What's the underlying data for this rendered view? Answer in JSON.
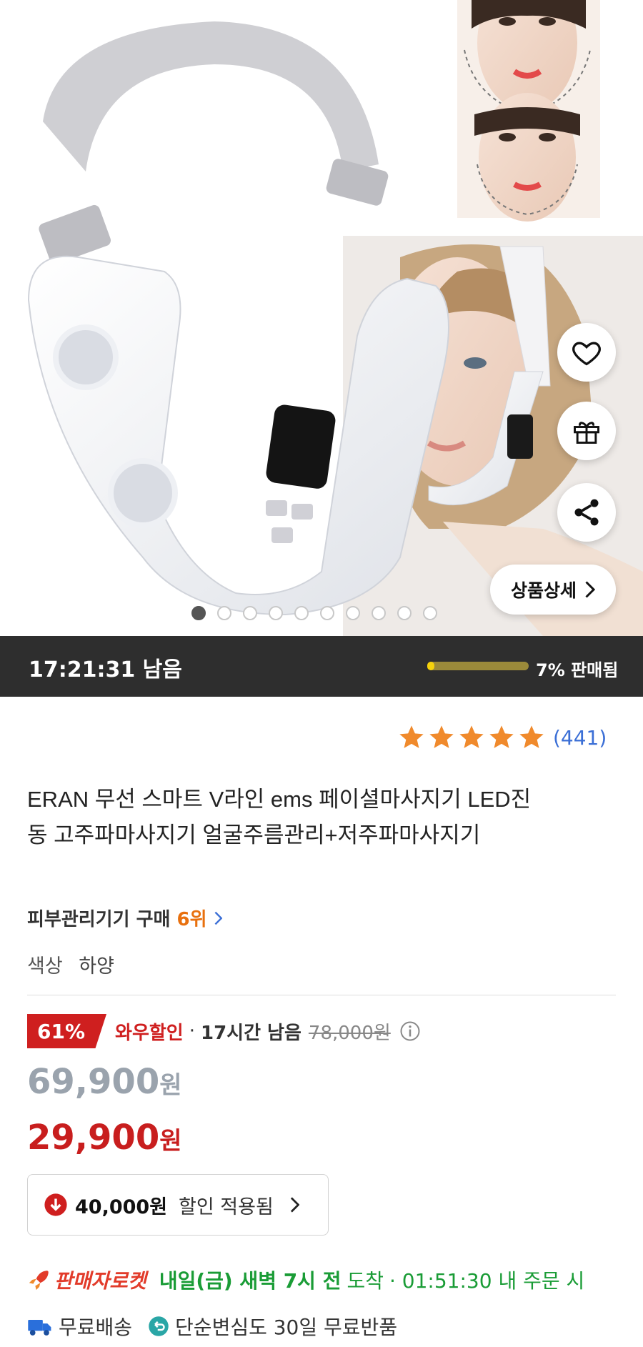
{
  "gallery": {
    "image_alt": "V-line face massager product with model",
    "detail_button": "상품상세",
    "page_count": 10,
    "active_index": 0
  },
  "deal": {
    "countdown": "17:21:31 남음",
    "sold_percent": 7,
    "sold_label": "7% 판매됨"
  },
  "rating": {
    "stars": 5,
    "review_count": "(441)"
  },
  "product": {
    "title": "ERAN 무선 스마트 V라인 ems 페이셜마사지기 LED진동 고주파마사지기 얼굴주름관리+저주파마사지기",
    "rank_prefix": "피부관리기기 구매",
    "rank_value": "6위",
    "option_label": "색상",
    "option_value": "하양"
  },
  "pricing": {
    "discount_badge": "61%",
    "promo_name": "와우할인",
    "promo_remaining": "17시간 남음",
    "original_price": "78,000원",
    "price_before_coupon": "69,900",
    "price_final": "29,900",
    "currency": "원",
    "coupon_amount": "40,000원",
    "coupon_status": "할인 적용됨"
  },
  "delivery": {
    "badge": "판매자로켓",
    "eta": "내일(금) 새벽 7시 전",
    "arrive_text": "도착",
    "cutoff": "· 01:51:30 내 주문 시",
    "free_shipping": "무료배송",
    "return_policy": "단순변심도 30일 무료반품"
  },
  "colors": {
    "accent_red": "#cf1f1f",
    "rating_orange": "#f08a2c",
    "link_blue": "#3b6fd6",
    "rocket_green": "#1a9c36"
  }
}
